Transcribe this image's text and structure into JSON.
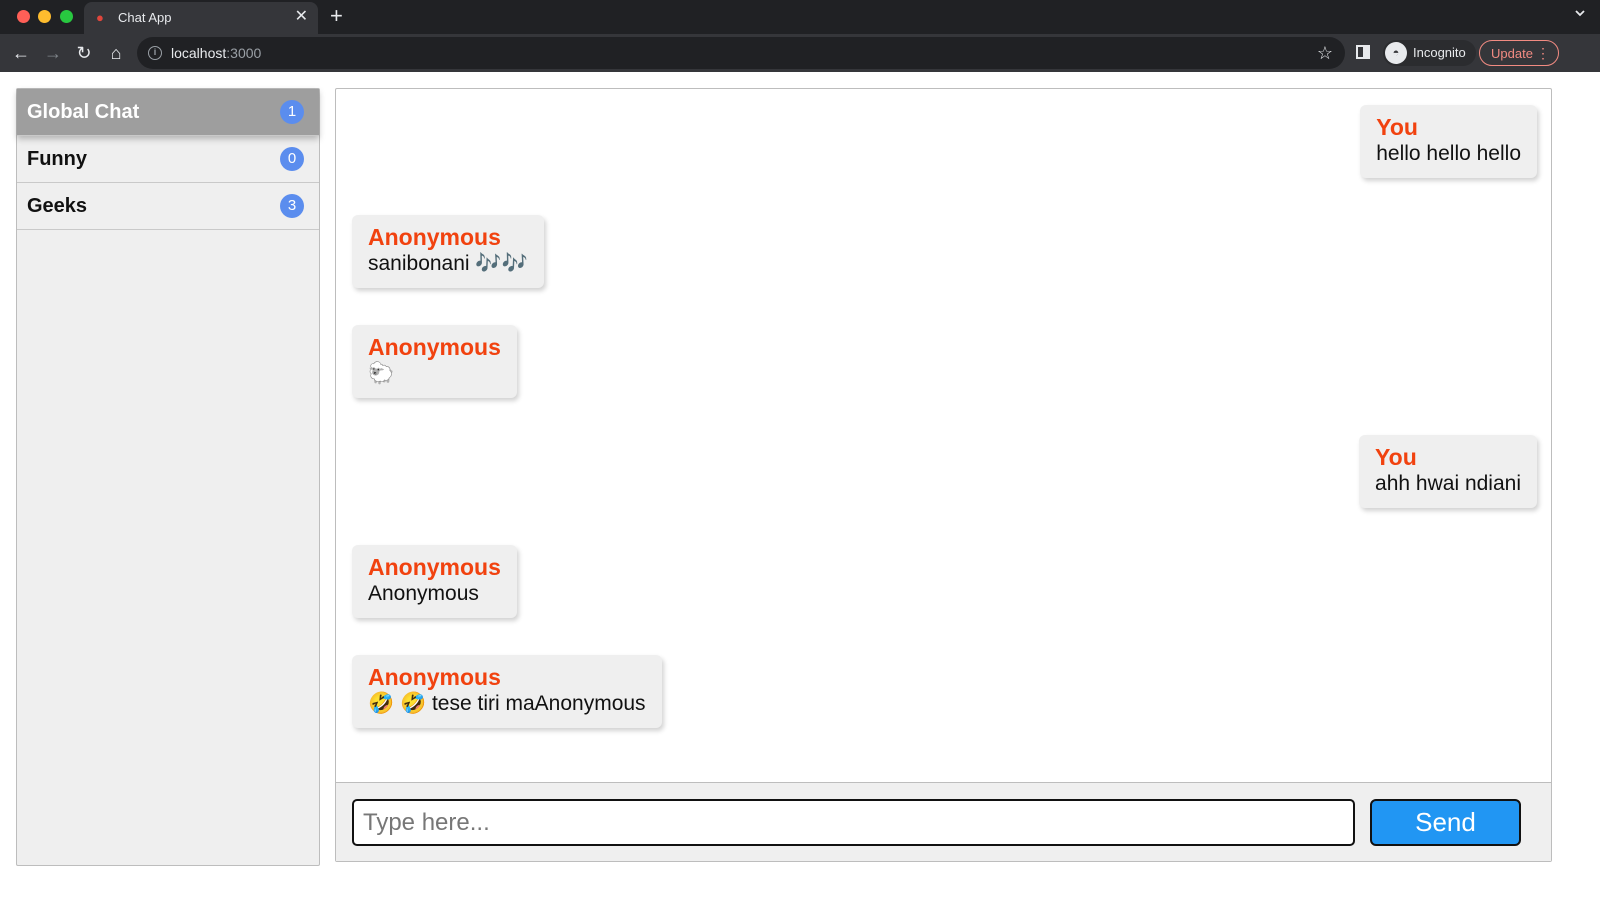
{
  "browser": {
    "tab_title": "Chat App",
    "tab_favicon": "apple-icon",
    "new_tab_label": "+",
    "url_host": "localhost",
    "url_port": ":3000",
    "incognito_label": "Incognito",
    "update_label": "Update"
  },
  "sidebar": {
    "rooms": [
      {
        "name": "Global Chat",
        "count": "1",
        "active": true
      },
      {
        "name": "Funny",
        "count": "0",
        "active": false
      },
      {
        "name": "Geeks",
        "count": "3",
        "active": false
      }
    ]
  },
  "messages": [
    {
      "author": "You",
      "text": "hello hello hello",
      "mine": true
    },
    {
      "author": "Anonymous",
      "text": "sanibonani 🎶🎶",
      "mine": false
    },
    {
      "author": "Anonymous",
      "text": "🐑",
      "mine": false
    },
    {
      "author": "You",
      "text": "ahh hwai ndiani",
      "mine": true
    },
    {
      "author": "Anonymous",
      "text": "Anonymous",
      "mine": false
    },
    {
      "author": "Anonymous",
      "text": "🤣 🤣 tese tiri maAnonymous",
      "mine": false
    }
  ],
  "composer": {
    "placeholder": "Type here...",
    "value": "",
    "send_label": "Send"
  },
  "colors": {
    "author": "#f1420f",
    "send_button": "#2196f3",
    "badge": "#5b8dee",
    "active_room": "#9e9e9e"
  }
}
